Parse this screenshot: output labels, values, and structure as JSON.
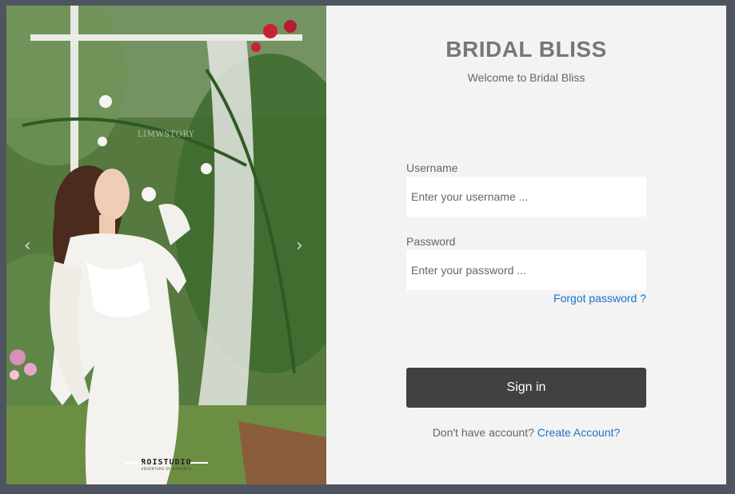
{
  "carousel": {
    "prev_icon": "chevron-left-icon",
    "next_icon": "chevron-right-icon",
    "prev_glyph": "‹",
    "next_glyph": "›",
    "watermark": "LIMWSTORY",
    "studio_name": "ROISTUDIO",
    "studio_tagline": "ADVENTURE OF ROMANCE"
  },
  "brand": {
    "title": "BRIDAL BLISS",
    "subtitle": "Welcome to Bridal Bliss"
  },
  "form": {
    "username_label": "Username",
    "username_placeholder": "Enter your username ...",
    "password_label": "Password",
    "password_placeholder": "Enter your password ...",
    "forgot_link": "Forgot password ?",
    "signin_label": "Sign in",
    "no_account_text": "Don't have account?",
    "create_account_link": "Create Account?"
  },
  "colors": {
    "page_background": "#4e5560",
    "panel_background": "#f3f3f3",
    "button_background": "#414141",
    "link": "#1a73c9"
  }
}
